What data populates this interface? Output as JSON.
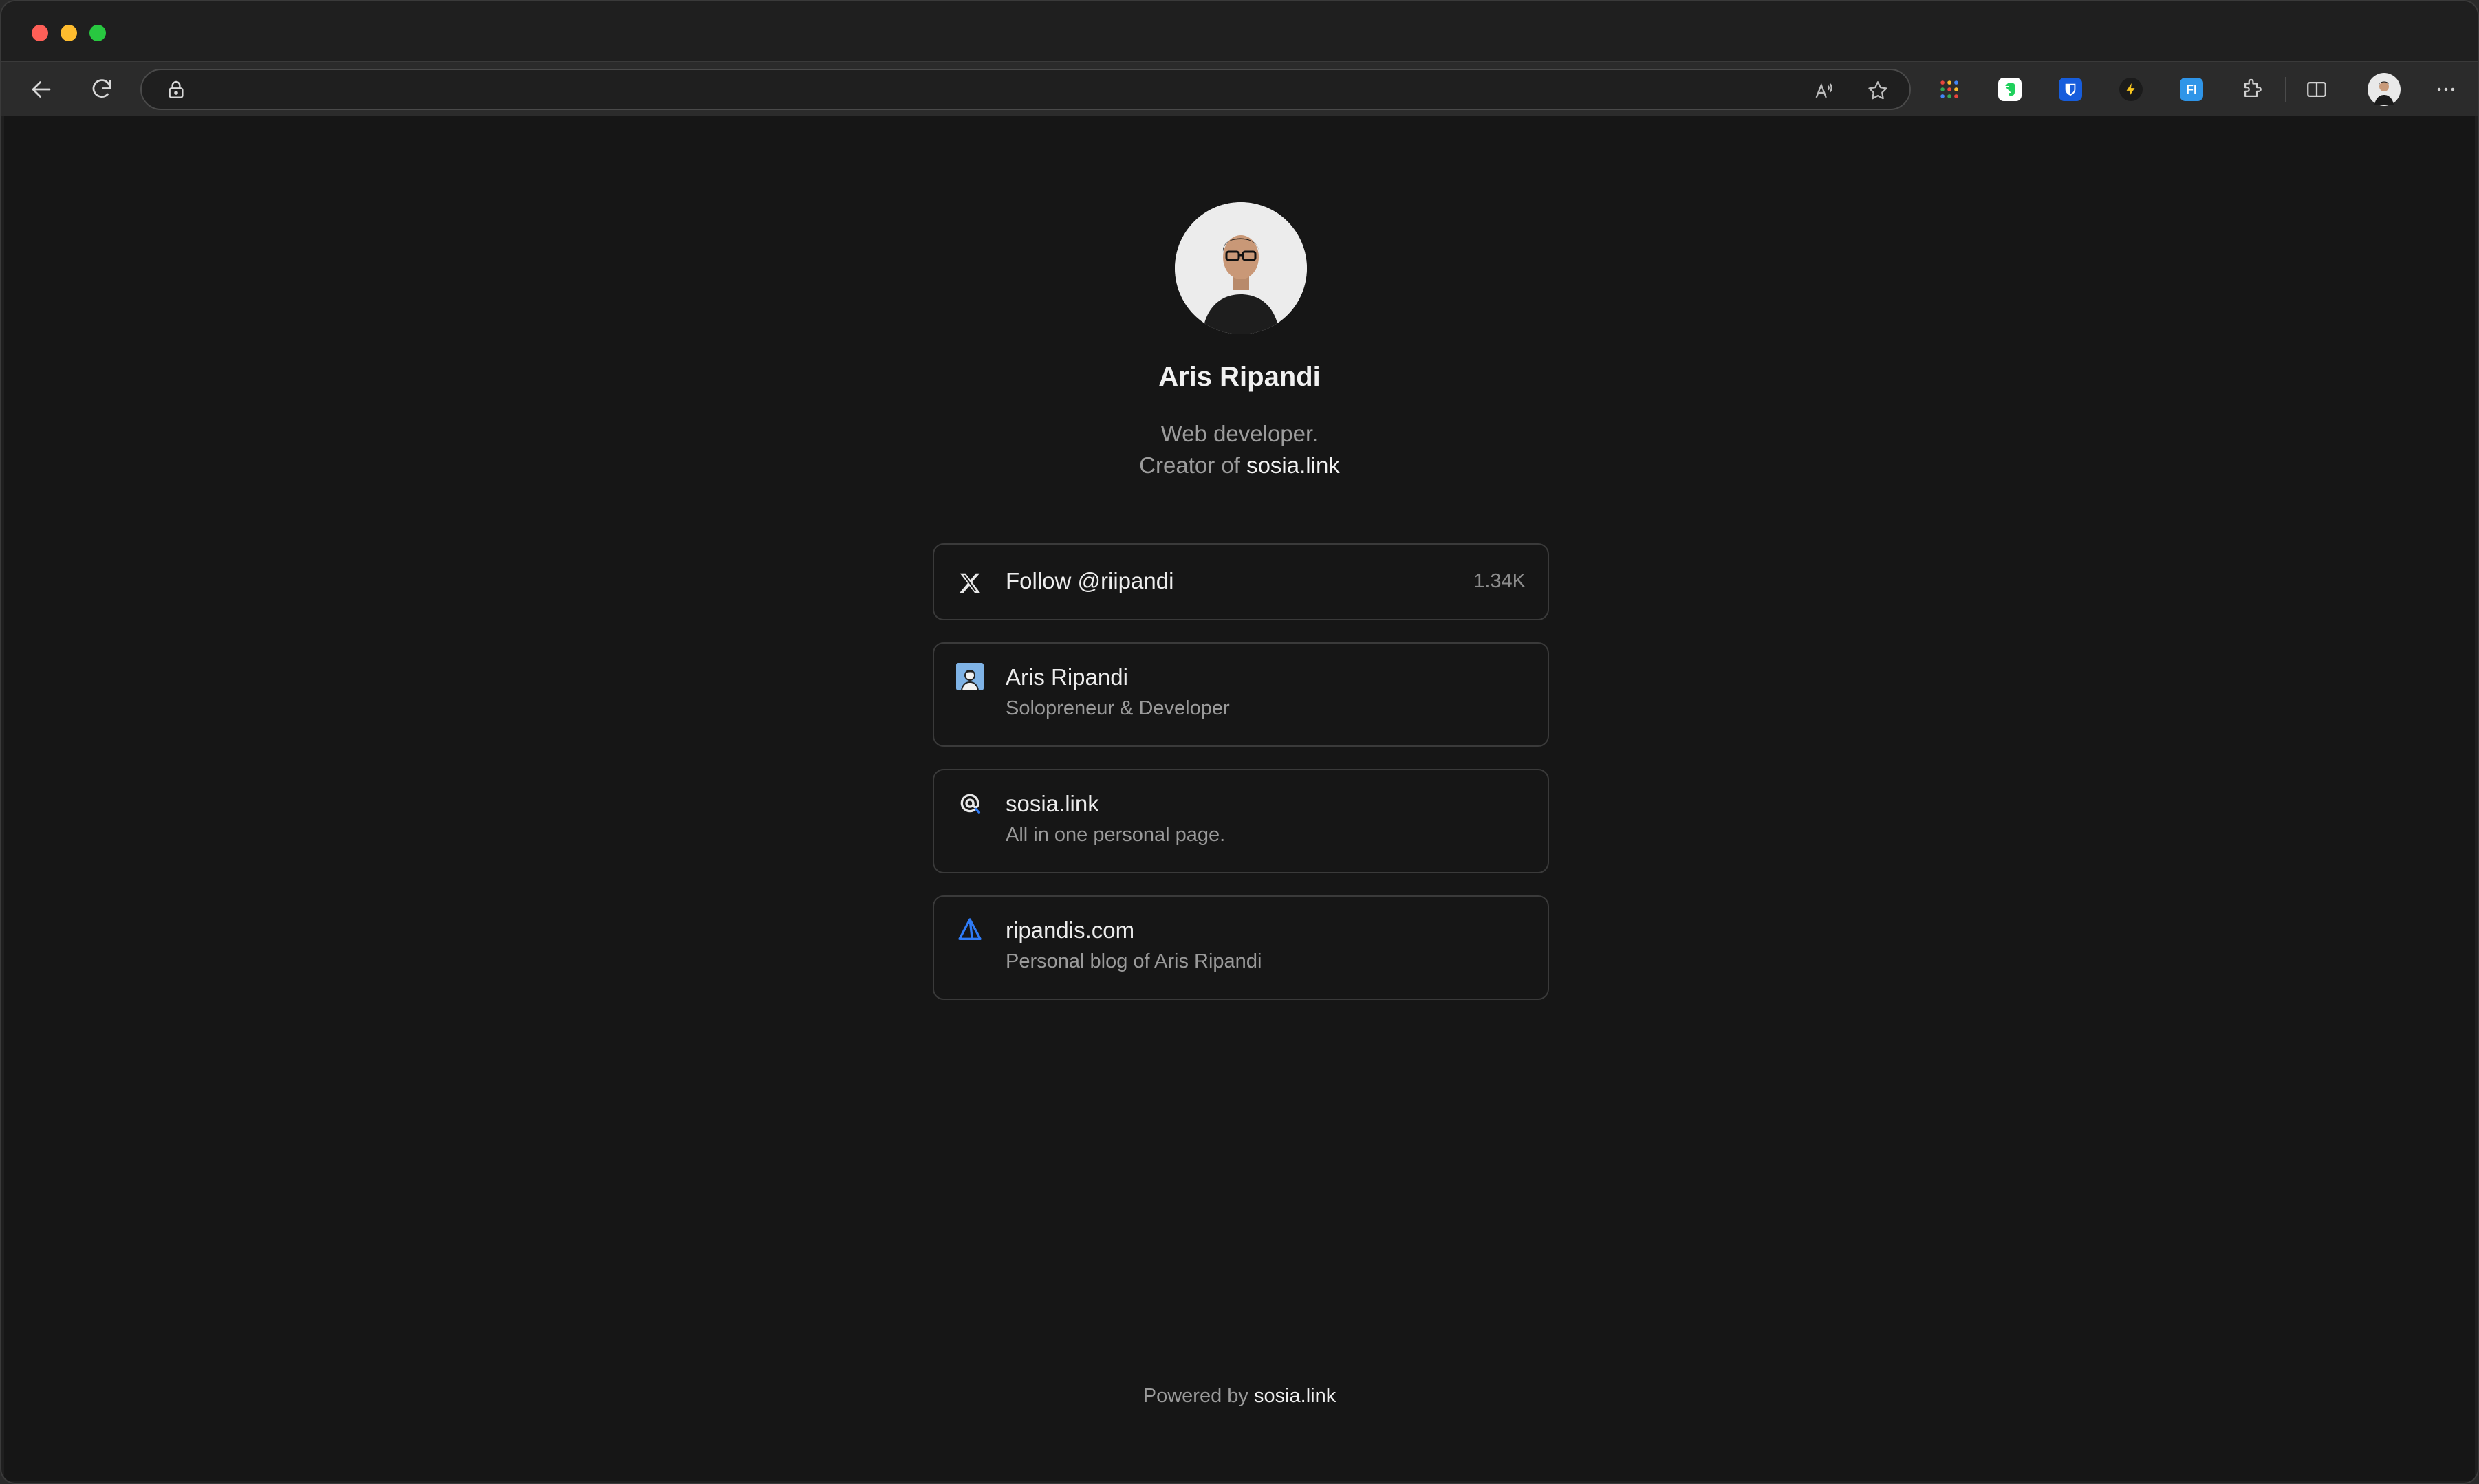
{
  "browser": {
    "address": {
      "value": "",
      "placeholder": ""
    },
    "extensions": [
      {
        "name": "apps-grid-icon"
      },
      {
        "name": "evernote-extension-icon"
      },
      {
        "name": "bitwarden-extension-icon"
      },
      {
        "name": "lightning-extension-icon"
      },
      {
        "name": "fi-extension-icon",
        "label": "FI"
      },
      {
        "name": "extensions-puzzle-icon"
      }
    ],
    "colors": {
      "accent_blue": "#2f7bf6",
      "evernote_green": "#1fd05c"
    }
  },
  "profile": {
    "name": "Aris Ripandi",
    "bio_line1": "Web developer.",
    "bio_line2_prefix": "Creator of",
    "bio_link": "sosia.link"
  },
  "links": {
    "twitter": {
      "title": "Follow @riipandi",
      "count": "1.34K",
      "icon": "x-logo-icon"
    },
    "aris": {
      "title": "Aris Ripandi",
      "subtitle": "Solopreneur & Developer",
      "icon": "avatar-thumbnail-icon"
    },
    "sosia": {
      "title": "sosia.link",
      "subtitle": "All in one personal page.",
      "icon": "sosia-logo-icon"
    },
    "ripandis": {
      "title": "ripandis.com",
      "subtitle": "Personal blog of Aris Ripandi",
      "icon": "ripandis-logo-icon"
    }
  },
  "footer": {
    "prefix": "Powered by",
    "link": "sosia.link"
  }
}
